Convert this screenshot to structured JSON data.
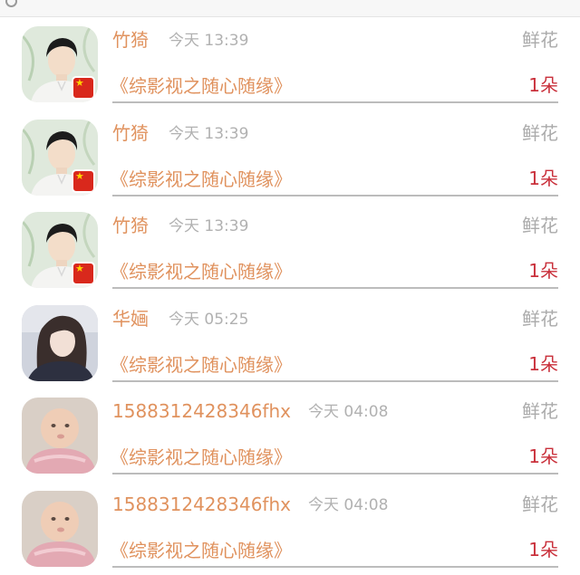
{
  "rows": [
    {
      "name": "竹猗",
      "time": "今天 13:39",
      "gift": "鲜花",
      "title": "《综影视之随心随缘》",
      "count": "1朵",
      "avatar": "man-avatar",
      "flag": true
    },
    {
      "name": "竹猗",
      "time": "今天 13:39",
      "gift": "鲜花",
      "title": "《综影视之随心随缘》",
      "count": "1朵",
      "avatar": "man-avatar",
      "flag": true
    },
    {
      "name": "竹猗",
      "time": "今天 13:39",
      "gift": "鲜花",
      "title": "《综影视之随心随缘》",
      "count": "1朵",
      "avatar": "man-avatar",
      "flag": true
    },
    {
      "name": "华婳",
      "time": "今天 05:25",
      "gift": "鲜花",
      "title": "《综影视之随心随缘》",
      "count": "1朵",
      "avatar": "woman-avatar",
      "flag": false
    },
    {
      "name": "1588312428346fhx",
      "time": "今天 04:08",
      "gift": "鲜花",
      "title": "《综影视之随心随缘》",
      "count": "1朵",
      "avatar": "baby-avatar",
      "flag": false
    },
    {
      "name": "1588312428346fhx",
      "time": "今天 04:08",
      "gift": "鲜花",
      "title": "《综影视之随心随缘》",
      "count": "1朵",
      "avatar": "baby-avatar",
      "flag": false
    }
  ],
  "colors": {
    "accent_text": "#e0925e",
    "count_text": "#c9303b",
    "muted_text": "#b1b1b1",
    "divider": "#bcbcbc"
  }
}
